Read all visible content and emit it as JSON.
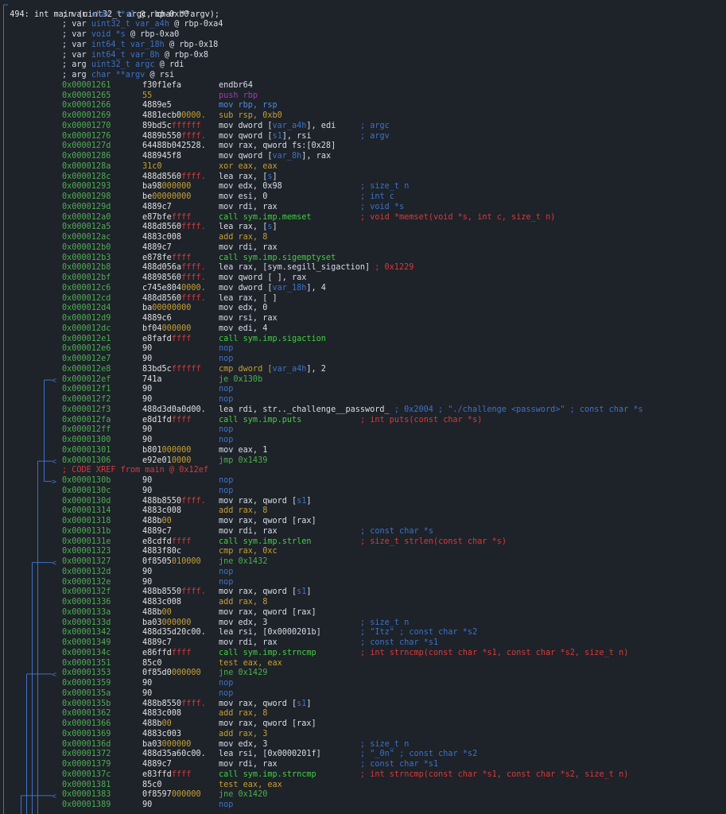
{
  "header": "494: int main (uint32_t argc, char **argv);",
  "vars": [
    {
      "pre": "; var ",
      "txt": "char **s1",
      "post": " @ rbp-0xb0"
    },
    {
      "pre": "; var ",
      "txt": "uint32_t var_a4h",
      "post": " @ rbp-0xa4"
    },
    {
      "pre": "; var ",
      "txt": "void *s",
      "post": " @ rbp-0xa0"
    },
    {
      "pre": "; var ",
      "txt": "int64_t var_18h",
      "post": " @ rbp-0x18"
    },
    {
      "pre": "; var ",
      "txt": "int64_t var_8h",
      "post": " @ rbp-0x8"
    },
    {
      "pre": "; arg ",
      "txt": "uint32_t argc",
      "post": " @ rdi"
    },
    {
      "pre": "; arg ",
      "txt": "char **argv",
      "post": " @ rsi"
    }
  ],
  "rows": [
    {
      "a": "0x00001261",
      "h": [
        [
          "f30f1efa",
          "#e0e0e0"
        ]
      ],
      "i": [
        [
          "endbr64",
          "#d8dee9"
        ]
      ]
    },
    {
      "a": "0x00001265",
      "h": [
        [
          "55",
          "#c6a032"
        ]
      ],
      "i": [
        [
          "push rbp",
          "#9c3fb0"
        ]
      ]
    },
    {
      "a": "0x00001266",
      "h": [
        [
          "4889e5",
          "#e0e0e0"
        ]
      ],
      "i": [
        [
          "mov rbp, rsp",
          "#4f8fe0"
        ]
      ]
    },
    {
      "a": "0x00001269",
      "h": [
        [
          "4881ecb0",
          "#e0e0e0"
        ],
        [
          "0000.",
          "#c6a032"
        ]
      ],
      "i": [
        [
          "sub rsp, 0xb0",
          "#c6a032"
        ]
      ]
    },
    {
      "a": "0x00001270",
      "h": [
        [
          "89bd5c",
          "#e0e0e0"
        ],
        [
          "ffffff",
          "#d83a3a"
        ]
      ],
      "i": [
        [
          "mov dword [",
          "#d8dee9"
        ],
        [
          "var_a4h",
          "#3b73c9"
        ],
        [
          "], edi",
          "#d8dee9"
        ]
      ],
      "c": "; argc"
    },
    {
      "a": "0x00001276",
      "h": [
        [
          "4889b550",
          "#e0e0e0"
        ],
        [
          "ffff.",
          "#d83a3a"
        ]
      ],
      "i": [
        [
          "mov qword [",
          "#d8dee9"
        ],
        [
          "s1",
          "#3b73c9"
        ],
        [
          "], rsi",
          "#d8dee9"
        ]
      ],
      "c": "; argv"
    },
    {
      "a": "0x0000127d",
      "h": [
        [
          "64488b042528.",
          "#e0e0e0"
        ]
      ],
      "i": [
        [
          "mov rax, qword fs:[0x28]",
          "#d8dee9"
        ]
      ]
    },
    {
      "a": "0x00001286",
      "h": [
        [
          "488945f8",
          "#e0e0e0"
        ]
      ],
      "i": [
        [
          "mov qword [",
          "#d8dee9"
        ],
        [
          "var_8h",
          "#3b73c9"
        ],
        [
          "], rax",
          "#d8dee9"
        ]
      ]
    },
    {
      "a": "0x0000128a",
      "h": [
        [
          "31c0",
          "#c6a032"
        ]
      ],
      "i": [
        [
          "xor eax, eax",
          "#c6a032"
        ]
      ]
    },
    {
      "a": "0x0000128c",
      "h": [
        [
          "488d8560",
          "#e0e0e0"
        ],
        [
          "ffff.",
          "#d83a3a"
        ]
      ],
      "i": [
        [
          "lea rax, [",
          "#d8dee9"
        ],
        [
          "s",
          "#3b73c9"
        ],
        [
          "]",
          "#d8dee9"
        ]
      ]
    },
    {
      "a": "0x00001293",
      "h": [
        [
          "ba98",
          "#e0e0e0"
        ],
        [
          "000000",
          "#c6a032"
        ]
      ],
      "i": [
        [
          "mov edx, 0x98",
          "#d8dee9"
        ]
      ],
      "c": "; size_t n"
    },
    {
      "a": "0x00001298",
      "h": [
        [
          "be",
          "#e0e0e0"
        ],
        [
          "00000000",
          "#c6a032"
        ]
      ],
      "i": [
        [
          "mov esi, 0",
          "#d8dee9"
        ]
      ],
      "c": "; int c"
    },
    {
      "a": "0x0000129d",
      "h": [
        [
          "4889c7",
          "#e0e0e0"
        ]
      ],
      "i": [
        [
          "mov rdi, rax",
          "#d8dee9"
        ]
      ],
      "c": "; void *s"
    },
    {
      "a": "0x000012a0",
      "h": [
        [
          "e87bfe",
          "#e0e0e0"
        ],
        [
          "ffff",
          "#d83a3a"
        ]
      ],
      "i": [
        [
          "call sym.imp.memset",
          "#3fd13f"
        ]
      ],
      "c": "; void *memset(void *s, int c, size_t n)",
      "cc": "#d83a3a"
    },
    {
      "a": "0x000012a5",
      "h": [
        [
          "488d8560",
          "#e0e0e0"
        ],
        [
          "ffff.",
          "#d83a3a"
        ]
      ],
      "i": [
        [
          "lea rax, [",
          "#d8dee9"
        ],
        [
          "s",
          "#3b73c9"
        ],
        [
          "]",
          "#d8dee9"
        ]
      ]
    },
    {
      "a": "0x000012ac",
      "h": [
        [
          "4883c008",
          "#e0e0e0"
        ]
      ],
      "i": [
        [
          "add rax, 8",
          "#c6a032"
        ]
      ]
    },
    {
      "a": "0x000012b0",
      "h": [
        [
          "4889c7",
          "#e0e0e0"
        ]
      ],
      "i": [
        [
          "mov rdi, rax",
          "#d8dee9"
        ]
      ]
    },
    {
      "a": "0x000012b3",
      "h": [
        [
          "e878fe",
          "#e0e0e0"
        ],
        [
          "ffff",
          "#d83a3a"
        ]
      ],
      "i": [
        [
          "call sym.imp.sigemptyset",
          "#3fd13f"
        ]
      ]
    },
    {
      "a": "0x000012b8",
      "h": [
        [
          "488d056a",
          "#e0e0e0"
        ],
        [
          "ffff.",
          "#d83a3a"
        ]
      ],
      "i": [
        [
          "lea rax, [sym.segill_sigaction]",
          "#d8dee9"
        ],
        [
          " ; 0x1229",
          "#d83a3a"
        ]
      ]
    },
    {
      "a": "0x000012bf",
      "h": [
        [
          "48898560",
          "#e0e0e0"
        ],
        [
          "ffff.",
          "#d83a3a"
        ]
      ],
      "i": [
        [
          "mov qword [ ], rax",
          "#d8dee9"
        ]
      ]
    },
    {
      "a": "0x000012c6",
      "h": [
        [
          "c745e804",
          "#e0e0e0"
        ],
        [
          "0000.",
          "#c6a032"
        ]
      ],
      "i": [
        [
          "mov dword [",
          "#d8dee9"
        ],
        [
          "var_18h",
          "#3b73c9"
        ],
        [
          "], 4",
          "#d8dee9"
        ]
      ]
    },
    {
      "a": "0x000012cd",
      "h": [
        [
          "488d8560",
          "#e0e0e0"
        ],
        [
          "ffff.",
          "#d83a3a"
        ]
      ],
      "i": [
        [
          "lea rax, [ ]",
          "#d8dee9"
        ]
      ]
    },
    {
      "a": "0x000012d4",
      "h": [
        [
          "ba",
          "#e0e0e0"
        ],
        [
          "00000000",
          "#c6a032"
        ]
      ],
      "i": [
        [
          "mov edx, 0",
          "#d8dee9"
        ]
      ]
    },
    {
      "a": "0x000012d9",
      "h": [
        [
          "4889c6",
          "#e0e0e0"
        ]
      ],
      "i": [
        [
          "mov rsi, rax",
          "#d8dee9"
        ]
      ]
    },
    {
      "a": "0x000012dc",
      "h": [
        [
          "bf04",
          "#e0e0e0"
        ],
        [
          "000000",
          "#c6a032"
        ]
      ],
      "i": [
        [
          "mov edi, 4",
          "#d8dee9"
        ]
      ]
    },
    {
      "a": "0x000012e1",
      "h": [
        [
          "e8fafd",
          "#e0e0e0"
        ],
        [
          "ffff",
          "#d83a3a"
        ]
      ],
      "i": [
        [
          "call sym.imp.sigaction",
          "#3fd13f"
        ]
      ]
    },
    {
      "a": "0x000012e6",
      "h": [
        [
          "90",
          "#e0e0e0"
        ]
      ],
      "i": [
        [
          "nop",
          "#3b73c9"
        ]
      ]
    },
    {
      "a": "0x000012e7",
      "h": [
        [
          "90",
          "#e0e0e0"
        ]
      ],
      "i": [
        [
          "nop",
          "#3b73c9"
        ]
      ]
    },
    {
      "a": "0x000012e8",
      "h": [
        [
          "83bd5c",
          "#e0e0e0"
        ],
        [
          "ffffff",
          "#d83a3a"
        ]
      ],
      "i": [
        [
          "cmp dword [",
          "#c6a032"
        ],
        [
          "var_a4h",
          "#3b73c9"
        ],
        [
          "], 2",
          "#d8dee9"
        ]
      ]
    },
    {
      "a": "0x000012ef",
      "h": [
        [
          "741a",
          "#e0e0e0"
        ]
      ],
      "i": [
        [
          "je 0x130b",
          "#4caf50"
        ]
      ],
      "mark": "<"
    },
    {
      "a": "0x000012f1",
      "h": [
        [
          "90",
          "#e0e0e0"
        ]
      ],
      "i": [
        [
          "nop",
          "#3b73c9"
        ]
      ]
    },
    {
      "a": "0x000012f2",
      "h": [
        [
          "90",
          "#e0e0e0"
        ]
      ],
      "i": [
        [
          "nop",
          "#3b73c9"
        ]
      ]
    },
    {
      "a": "0x000012f3",
      "h": [
        [
          "488d3d0a0d00.",
          "#e0e0e0"
        ]
      ],
      "i": [
        [
          "lea rdi, str.._challenge__password_",
          "#d8dee9"
        ],
        [
          " ; 0x2004 ; \"./challenge <password>\" ; const char *s",
          "#3b73c9"
        ]
      ]
    },
    {
      "a": "0x000012fa",
      "h": [
        [
          "e8d1fd",
          "#e0e0e0"
        ],
        [
          "ffff",
          "#d83a3a"
        ]
      ],
      "i": [
        [
          "call sym.imp.puts",
          "#3fd13f"
        ]
      ],
      "c": "; int puts(const char *s)",
      "cc": "#d83a3a"
    },
    {
      "a": "0x000012ff",
      "h": [
        [
          "90",
          "#e0e0e0"
        ]
      ],
      "i": [
        [
          "nop",
          "#3b73c9"
        ]
      ]
    },
    {
      "a": "0x00001300",
      "h": [
        [
          "90",
          "#e0e0e0"
        ]
      ],
      "i": [
        [
          "nop",
          "#3b73c9"
        ]
      ]
    },
    {
      "a": "0x00001301",
      "h": [
        [
          "b801",
          "#e0e0e0"
        ],
        [
          "000000",
          "#c6a032"
        ]
      ],
      "i": [
        [
          "mov eax, 1",
          "#d8dee9"
        ]
      ]
    },
    {
      "a": "0x00001306",
      "h": [
        [
          "e92e01",
          "#e0e0e0"
        ],
        [
          "0000",
          "#c6a032"
        ]
      ],
      "i": [
        [
          "jmp 0x1439",
          "#4caf50"
        ]
      ],
      "mark": "<"
    },
    {
      "xref": "; CODE XREF from main @ 0x12ef"
    },
    {
      "a": "0x0000130b",
      "h": [
        [
          "90",
          "#e0e0e0"
        ]
      ],
      "i": [
        [
          "nop",
          "#3b73c9"
        ]
      ],
      "mark": ">"
    },
    {
      "a": "0x0000130c",
      "h": [
        [
          "90",
          "#e0e0e0"
        ]
      ],
      "i": [
        [
          "nop",
          "#3b73c9"
        ]
      ]
    },
    {
      "a": "0x0000130d",
      "h": [
        [
          "488b8550",
          "#e0e0e0"
        ],
        [
          "ffff.",
          "#d83a3a"
        ]
      ],
      "i": [
        [
          "mov rax, qword [",
          "#d8dee9"
        ],
        [
          "s1",
          "#3b73c9"
        ],
        [
          "]",
          "#d8dee9"
        ]
      ]
    },
    {
      "a": "0x00001314",
      "h": [
        [
          "4883c008",
          "#e0e0e0"
        ]
      ],
      "i": [
        [
          "add rax, 8",
          "#c6a032"
        ]
      ]
    },
    {
      "a": "0x00001318",
      "h": [
        [
          "488b",
          "#e0e0e0"
        ],
        [
          "00",
          "#c6a032"
        ]
      ],
      "i": [
        [
          "mov rax, qword [rax]",
          "#d8dee9"
        ]
      ]
    },
    {
      "a": "0x0000131b",
      "h": [
        [
          "4889c7",
          "#e0e0e0"
        ]
      ],
      "i": [
        [
          "mov rdi, rax",
          "#d8dee9"
        ]
      ],
      "c": "; const char *s"
    },
    {
      "a": "0x0000131e",
      "h": [
        [
          "e8cdfd",
          "#e0e0e0"
        ],
        [
          "ffff",
          "#d83a3a"
        ]
      ],
      "i": [
        [
          "call sym.imp.strlen",
          "#3fd13f"
        ]
      ],
      "c": "; size_t strlen(const char *s)",
      "cc": "#d83a3a"
    },
    {
      "a": "0x00001323",
      "h": [
        [
          "4883f80c",
          "#e0e0e0"
        ]
      ],
      "i": [
        [
          "cmp rax, 0xc",
          "#c6a032"
        ]
      ]
    },
    {
      "a": "0x00001327",
      "h": [
        [
          "0f8505",
          "#e0e0e0"
        ],
        [
          "010000",
          "#c6a032"
        ]
      ],
      "i": [
        [
          "jne 0x1432",
          "#4caf50"
        ]
      ],
      "mark": "<"
    },
    {
      "a": "0x0000132d",
      "h": [
        [
          "90",
          "#e0e0e0"
        ]
      ],
      "i": [
        [
          "nop",
          "#3b73c9"
        ]
      ]
    },
    {
      "a": "0x0000132e",
      "h": [
        [
          "90",
          "#e0e0e0"
        ]
      ],
      "i": [
        [
          "nop",
          "#3b73c9"
        ]
      ]
    },
    {
      "a": "0x0000132f",
      "h": [
        [
          "488b8550",
          "#e0e0e0"
        ],
        [
          "ffff.",
          "#d83a3a"
        ]
      ],
      "i": [
        [
          "mov rax, qword [",
          "#d8dee9"
        ],
        [
          "s1",
          "#3b73c9"
        ],
        [
          "]",
          "#d8dee9"
        ]
      ]
    },
    {
      "a": "0x00001336",
      "h": [
        [
          "4883c008",
          "#e0e0e0"
        ]
      ],
      "i": [
        [
          "add rax, 8",
          "#c6a032"
        ]
      ]
    },
    {
      "a": "0x0000133a",
      "h": [
        [
          "488b",
          "#e0e0e0"
        ],
        [
          "00",
          "#c6a032"
        ]
      ],
      "i": [
        [
          "mov rax, qword [rax]",
          "#d8dee9"
        ]
      ]
    },
    {
      "a": "0x0000133d",
      "h": [
        [
          "ba03",
          "#e0e0e0"
        ],
        [
          "000000",
          "#c6a032"
        ]
      ],
      "i": [
        [
          "mov edx, 3",
          "#d8dee9"
        ]
      ],
      "c": "; size_t n"
    },
    {
      "a": "0x00001342",
      "h": [
        [
          "488d35d20c00.",
          "#e0e0e0"
        ]
      ],
      "i": [
        [
          "lea rsi, [0x0000201b]",
          "#d8dee9"
        ]
      ],
      "c": "; \"Itz\" ; const char *s2"
    },
    {
      "a": "0x00001349",
      "h": [
        [
          "4889c7",
          "#e0e0e0"
        ]
      ],
      "i": [
        [
          "mov rdi, rax",
          "#d8dee9"
        ]
      ],
      "c": "; const char *s1"
    },
    {
      "a": "0x0000134c",
      "h": [
        [
          "e86ffd",
          "#e0e0e0"
        ],
        [
          "ffff",
          "#d83a3a"
        ]
      ],
      "i": [
        [
          "call sym.imp.strncmp",
          "#3fd13f"
        ]
      ],
      "c": "; int strncmp(const char *s1, const char *s2, size_t n)",
      "cc": "#d83a3a"
    },
    {
      "a": "0x00001351",
      "h": [
        [
          "85c0",
          "#e0e0e0"
        ]
      ],
      "i": [
        [
          "test eax, eax",
          "#c6a032"
        ]
      ]
    },
    {
      "a": "0x00001353",
      "h": [
        [
          "0f85d0",
          "#e0e0e0"
        ],
        [
          "000000",
          "#c6a032"
        ]
      ],
      "i": [
        [
          "jne 0x1429",
          "#4caf50"
        ]
      ],
      "mark": "<"
    },
    {
      "a": "0x00001359",
      "h": [
        [
          "90",
          "#e0e0e0"
        ]
      ],
      "i": [
        [
          "nop",
          "#3b73c9"
        ]
      ]
    },
    {
      "a": "0x0000135a",
      "h": [
        [
          "90",
          "#e0e0e0"
        ]
      ],
      "i": [
        [
          "nop",
          "#3b73c9"
        ]
      ]
    },
    {
      "a": "0x0000135b",
      "h": [
        [
          "488b8550",
          "#e0e0e0"
        ],
        [
          "ffff.",
          "#d83a3a"
        ]
      ],
      "i": [
        [
          "mov rax, qword [",
          "#d8dee9"
        ],
        [
          "s1",
          "#3b73c9"
        ],
        [
          "]",
          "#d8dee9"
        ]
      ]
    },
    {
      "a": "0x00001362",
      "h": [
        [
          "4883c008",
          "#e0e0e0"
        ]
      ],
      "i": [
        [
          "add rax, 8",
          "#c6a032"
        ]
      ]
    },
    {
      "a": "0x00001366",
      "h": [
        [
          "488b",
          "#e0e0e0"
        ],
        [
          "00",
          "#c6a032"
        ]
      ],
      "i": [
        [
          "mov rax, qword [rax]",
          "#d8dee9"
        ]
      ]
    },
    {
      "a": "0x00001369",
      "h": [
        [
          "4883c003",
          "#e0e0e0"
        ]
      ],
      "i": [
        [
          "add rax, 3",
          "#c6a032"
        ]
      ]
    },
    {
      "a": "0x0000136d",
      "h": [
        [
          "ba03",
          "#e0e0e0"
        ],
        [
          "000000",
          "#c6a032"
        ]
      ],
      "i": [
        [
          "mov edx, 3",
          "#d8dee9"
        ]
      ],
      "c": "; size_t n"
    },
    {
      "a": "0x00001372",
      "h": [
        [
          "488d35a60c00.",
          "#e0e0e0"
        ]
      ],
      "i": [
        [
          "lea rsi, [0x0000201f]",
          "#d8dee9"
        ]
      ],
      "c": "; \"_0n\" ; const char *s2"
    },
    {
      "a": "0x00001379",
      "h": [
        [
          "4889c7",
          "#e0e0e0"
        ]
      ],
      "i": [
        [
          "mov rdi, rax",
          "#d8dee9"
        ]
      ],
      "c": "; const char *s1"
    },
    {
      "a": "0x0000137c",
      "h": [
        [
          "e83ffd",
          "#e0e0e0"
        ],
        [
          "ffff",
          "#d83a3a"
        ]
      ],
      "i": [
        [
          "call sym.imp.strncmp",
          "#3fd13f"
        ]
      ],
      "c": "; int strncmp(const char *s1, const char *s2, size_t n)",
      "cc": "#d83a3a"
    },
    {
      "a": "0x00001381",
      "h": [
        [
          "85c0",
          "#e0e0e0"
        ]
      ],
      "i": [
        [
          "test eax, eax",
          "#c6a032"
        ]
      ]
    },
    {
      "a": "0x00001383",
      "h": [
        [
          "0f8597",
          "#e0e0e0"
        ],
        [
          "000000",
          "#c6a032"
        ]
      ],
      "i": [
        [
          "jne 0x1420",
          "#4caf50"
        ]
      ],
      "mark": "<"
    },
    {
      "a": "0x00001389",
      "h": [
        [
          "90",
          "#e0e0e0"
        ]
      ],
      "i": [
        [
          "nop",
          "#3b73c9"
        ]
      ]
    }
  ],
  "colors": {
    "background": "#1e2229",
    "address": "#4caf50",
    "flow_line": "#3b73c9",
    "comment": "#3b73c9",
    "xref": "#d83a3a",
    "call": "#3fd13f"
  }
}
